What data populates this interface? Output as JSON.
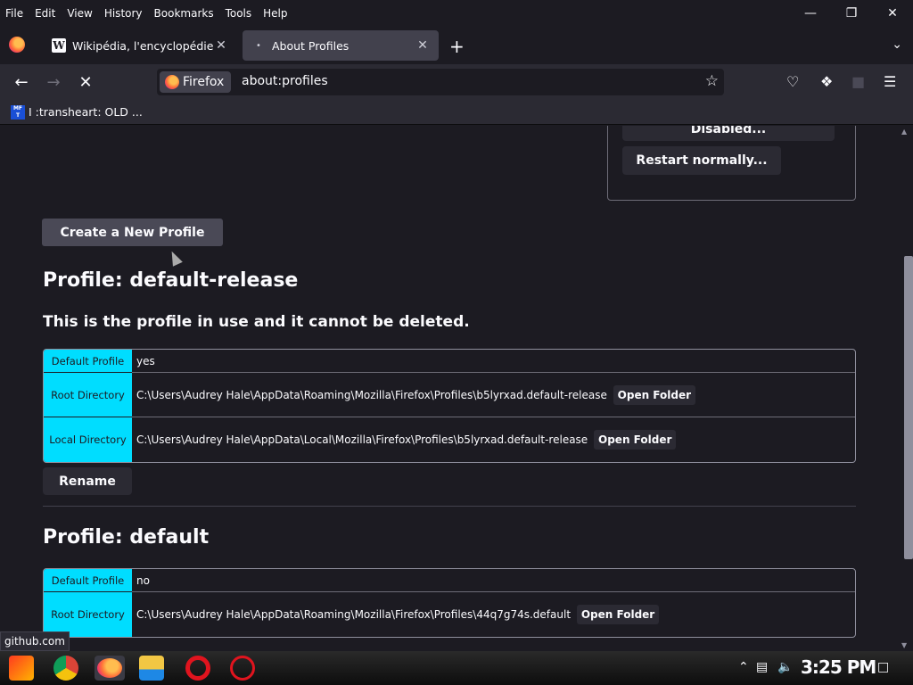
{
  "menubar": {
    "items": [
      {
        "label": "File"
      },
      {
        "label": "Edit"
      },
      {
        "label": "View"
      },
      {
        "label": "History"
      },
      {
        "label": "Bookmarks"
      },
      {
        "label": "Tools"
      },
      {
        "label": "Help"
      }
    ]
  },
  "tabs": [
    {
      "title": "Wikipédia, l'encyclopédie libre",
      "favicon": "wikipedia-w-icon",
      "active": false
    },
    {
      "title": "About Profiles",
      "favicon": "loading-dot-icon",
      "active": true
    }
  ],
  "navbar": {
    "identity_label": "Firefox",
    "url": "about:profiles"
  },
  "bookmarks": [
    {
      "icon_text": "MF T",
      "label": "I :transheart: OLD ..."
    }
  ],
  "restart": {
    "disabled_label": "Disabled...",
    "restart_normally_label": "Restart normally..."
  },
  "create_profile_label": "Create a New Profile",
  "profiles": [
    {
      "heading": "Profile: default-release",
      "in_use_note": "This is the profile in use and it cannot be deleted.",
      "rows": [
        {
          "key": "Default Profile",
          "value": "yes",
          "button": ""
        },
        {
          "key": "Root Directory",
          "value": "C:\\Users\\Audrey Hale\\AppData\\Roaming\\Mozilla\\Firefox\\Profiles\\b5lyrxad.default-release",
          "button": "Open Folder"
        },
        {
          "key": "Local Directory",
          "value": "C:\\Users\\Audrey Hale\\AppData\\Local\\Mozilla\\Firefox\\Profiles\\b5lyrxad.default-release",
          "button": "Open Folder"
        }
      ],
      "rename_label": "Rename"
    },
    {
      "heading": "Profile: default",
      "rows": [
        {
          "key": "Default Profile",
          "value": "no",
          "button": ""
        },
        {
          "key": "Root Directory",
          "value": "C:\\Users\\Audrey Hale\\AppData\\Roaming\\Mozilla\\Firefox\\Profiles\\44q7g74s.default",
          "button": "Open Folder"
        }
      ]
    }
  ],
  "status_url": "github.com",
  "taskbar": {
    "apps": [
      "start-icon",
      "chrome-icon",
      "firefox-icon",
      "file-explorer-icon",
      "opera-icon",
      "opera-gx-icon"
    ],
    "clock": "3:25 PM"
  },
  "colors": {
    "accent_cyan": "#00ddff",
    "page_bg": "#1c1b22",
    "toolbar_bg": "#2b2a33"
  }
}
